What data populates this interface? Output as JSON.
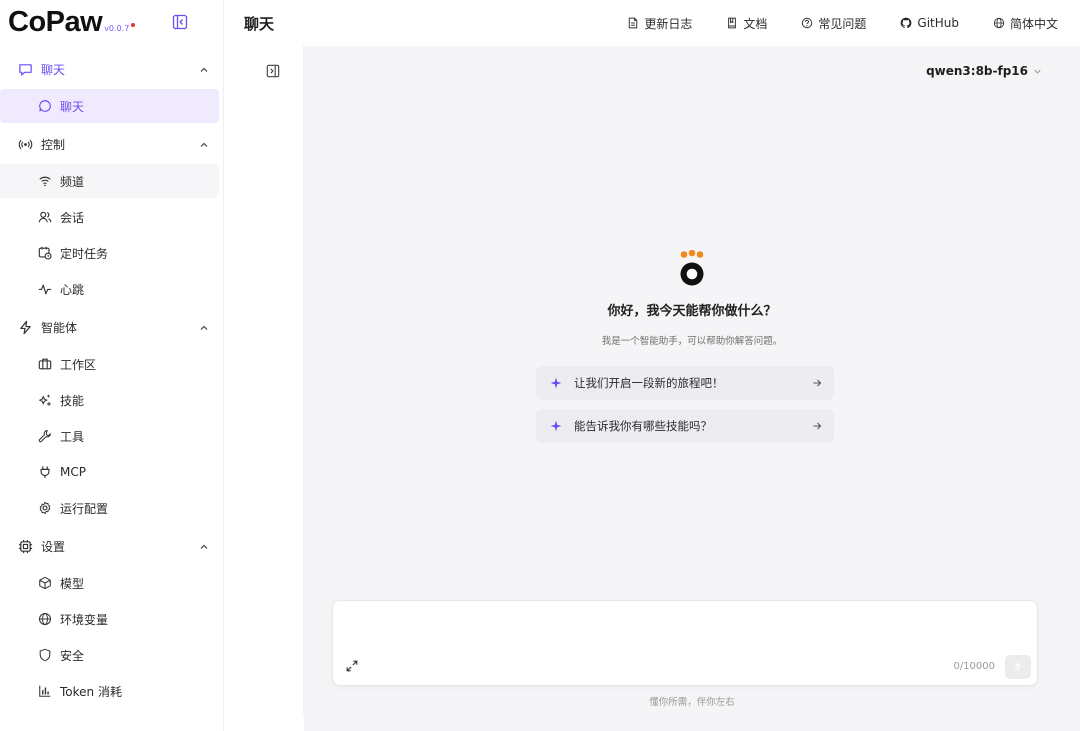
{
  "app": {
    "logo": "CoPaw",
    "version": "v0.0.7"
  },
  "header": {
    "title": "聊天",
    "links": [
      {
        "label": "更新日志",
        "icon": "changelog-icon"
      },
      {
        "label": "文档",
        "icon": "docs-icon"
      },
      {
        "label": "常见问题",
        "icon": "faq-icon"
      },
      {
        "label": "GitHub",
        "icon": "github-icon"
      },
      {
        "label": "简体中文",
        "icon": "globe-icon"
      }
    ]
  },
  "sidebar": {
    "groups": [
      {
        "label": "聊天",
        "icon": "chat-bubble-icon",
        "items": [
          {
            "label": "聊天",
            "icon": "chat-circle-icon"
          }
        ]
      },
      {
        "label": "控制",
        "icon": "broadcast-icon",
        "items": [
          {
            "label": "频道",
            "icon": "wifi-icon"
          },
          {
            "label": "会话",
            "icon": "users-icon"
          },
          {
            "label": "定时任务",
            "icon": "calendar-clock-icon"
          },
          {
            "label": "心跳",
            "icon": "heartbeat-icon"
          }
        ]
      },
      {
        "label": "智能体",
        "icon": "lightning-icon",
        "items": [
          {
            "label": "工作区",
            "icon": "briefcase-icon"
          },
          {
            "label": "技能",
            "icon": "sparkles-icon"
          },
          {
            "label": "工具",
            "icon": "wrench-icon"
          },
          {
            "label": "MCP",
            "icon": "plug-icon"
          },
          {
            "label": "运行配置",
            "icon": "gear-icon"
          }
        ]
      },
      {
        "label": "设置",
        "icon": "chip-icon",
        "items": [
          {
            "label": "模型",
            "icon": "cube-icon"
          },
          {
            "label": "环境变量",
            "icon": "globe-icon"
          },
          {
            "label": "安全",
            "icon": "shield-icon"
          },
          {
            "label": "Token 消耗",
            "icon": "bar-chart-icon"
          }
        ]
      }
    ]
  },
  "main": {
    "model": "qwen3:8b-fp16",
    "welcome_title": "你好，我今天能帮你做什么？",
    "welcome_subtitle": "我是一个智能助手，可以帮助你解答问题。",
    "suggestions": [
      "让我们开启一段新的旅程吧！",
      "能告诉我你有哪些技能吗？"
    ],
    "composer": {
      "counter": "0/10000"
    },
    "footer": "懂你所需，伴你左右"
  },
  "colors": {
    "accent": "#6c4cf5",
    "selected_bg": "#efeafd",
    "paw_orange": "#f5891f"
  }
}
